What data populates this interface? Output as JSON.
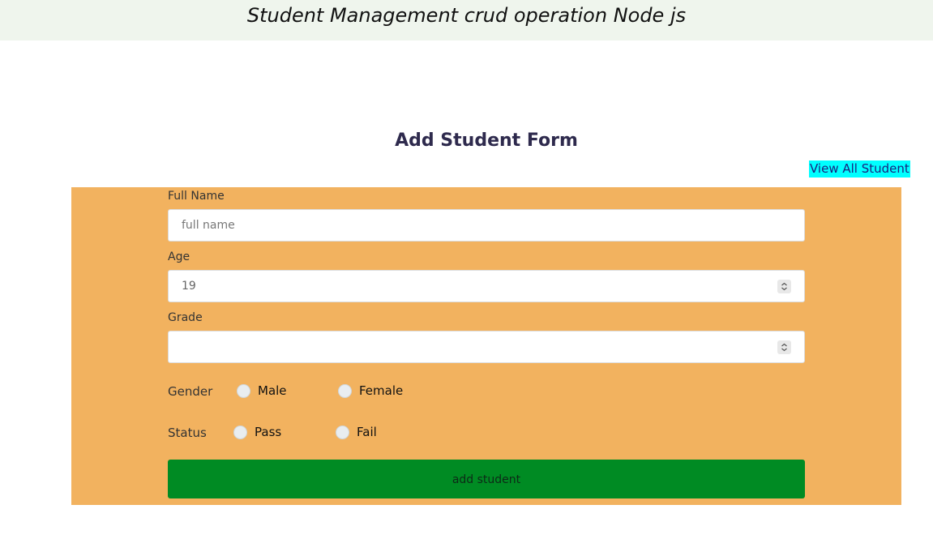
{
  "header": {
    "title": "Student Management crud operation Node js"
  },
  "form": {
    "title": "Add Student Form",
    "view_all_link": "View All Student",
    "full_name": {
      "label": "Full Name",
      "placeholder": "full name",
      "value": ""
    },
    "age": {
      "label": "Age",
      "value": "19"
    },
    "grade": {
      "label": "Grade",
      "value": ""
    },
    "gender": {
      "label": "Gender",
      "options": [
        "Male",
        "Female"
      ],
      "selected": null
    },
    "status": {
      "label": "Status",
      "options": [
        "Pass",
        "Fail"
      ],
      "selected": null
    },
    "submit_label": "add student"
  },
  "colors": {
    "header_bg": "#eff5ed",
    "panel_bg": "#f2b25f",
    "link_bg": "#00ffff",
    "submit_bg": "#008b23"
  }
}
